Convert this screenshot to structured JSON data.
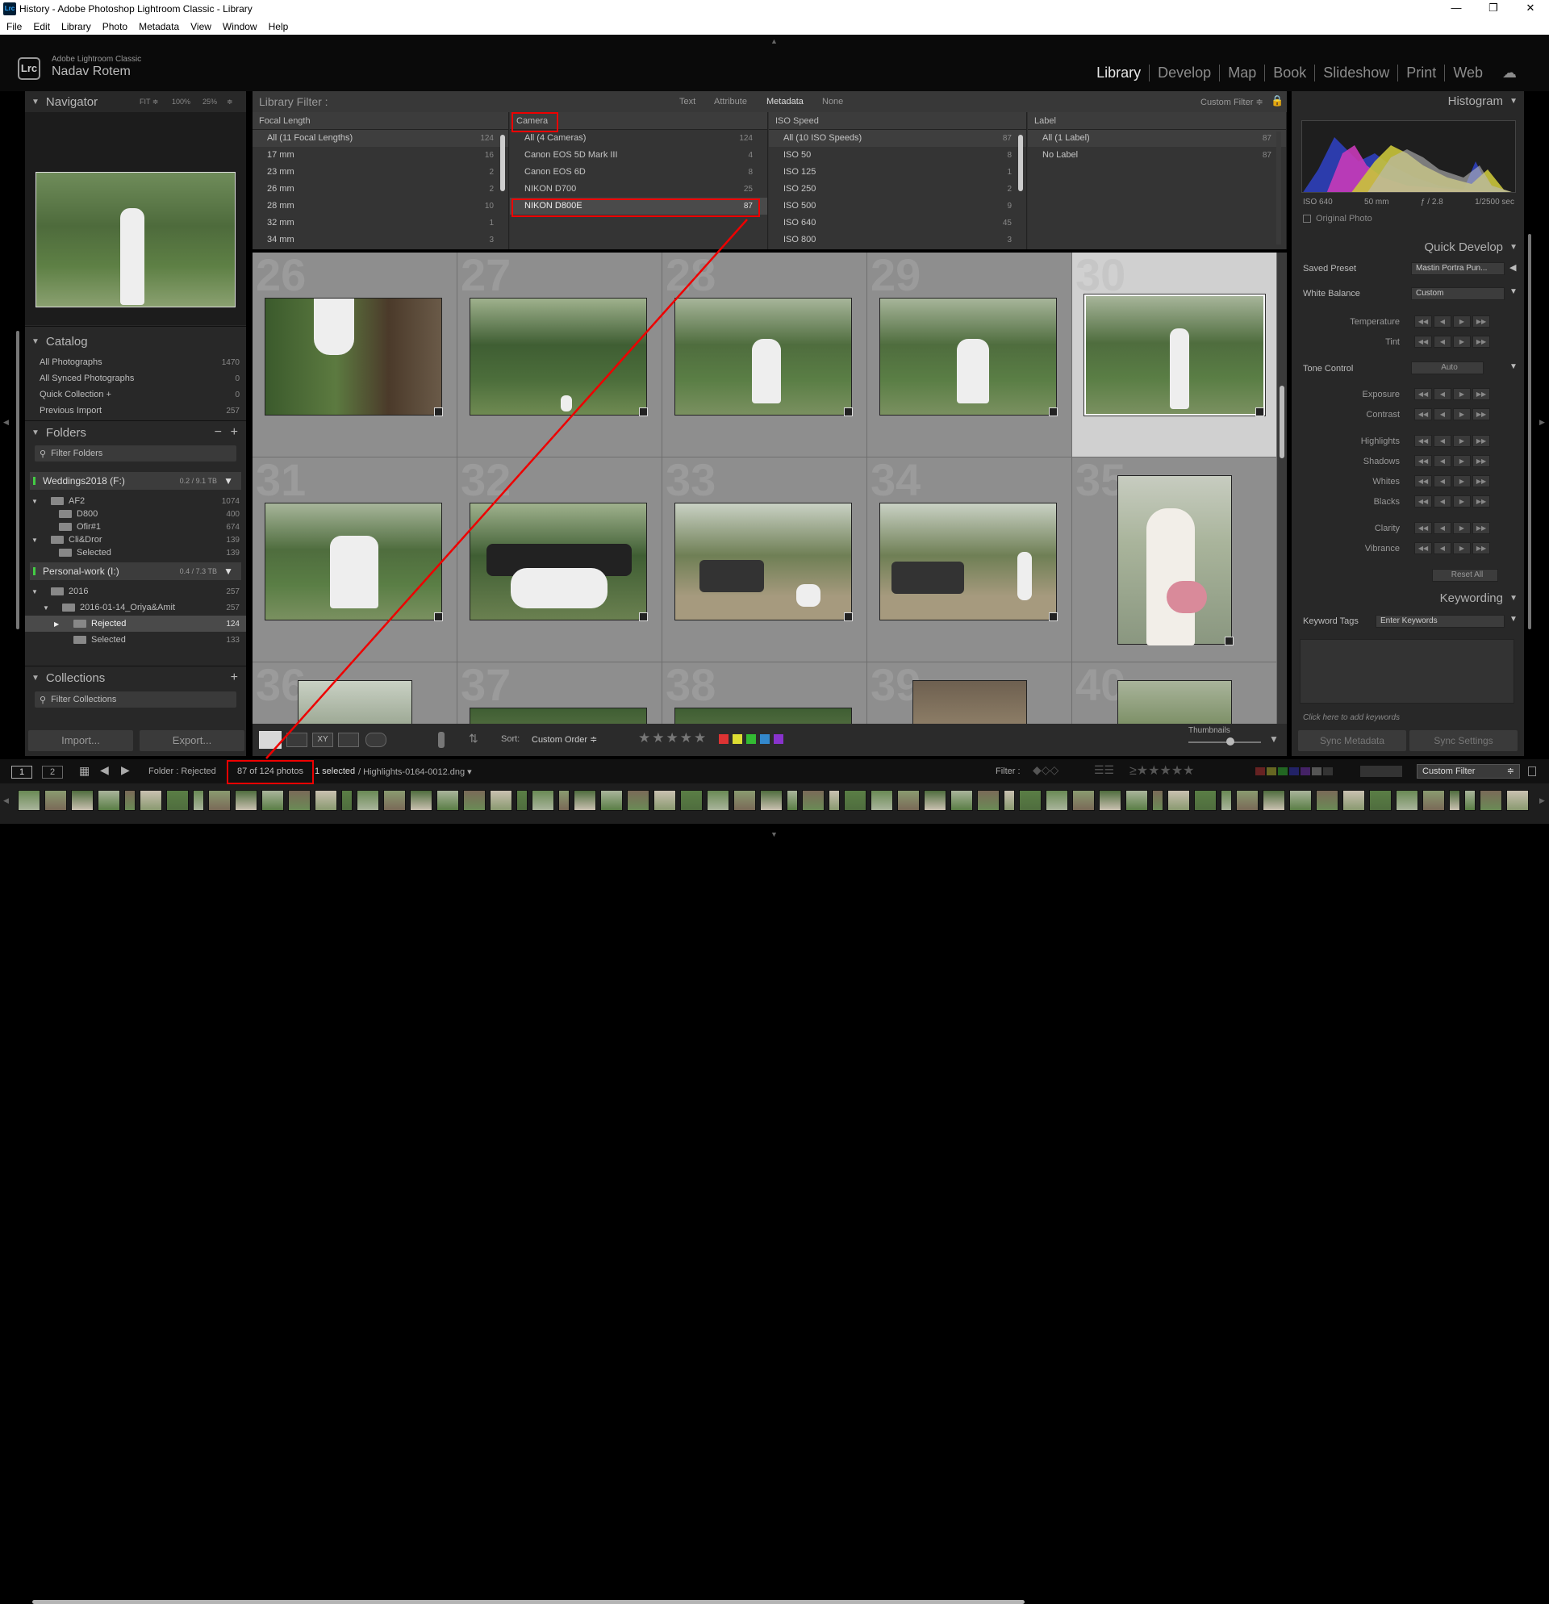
{
  "window": {
    "title": "History - Adobe Photoshop Lightroom Classic - Library",
    "app_icon": "Lrc"
  },
  "menu": [
    "File",
    "Edit",
    "Library",
    "Photo",
    "Metadata",
    "View",
    "Window",
    "Help"
  ],
  "identity": {
    "logo": "Lrc",
    "brand": "Adobe Lightroom Classic",
    "user": "Nadav Rotem"
  },
  "modules": [
    "Library",
    "Develop",
    "Map",
    "Book",
    "Slideshow",
    "Print",
    "Web"
  ],
  "navigator": {
    "title": "Navigator",
    "zoom_options": [
      "FIT ≑",
      "100%",
      "25%",
      "≑"
    ]
  },
  "catalog": {
    "title": "Catalog",
    "items": [
      {
        "label": "All Photographs",
        "count": "1470"
      },
      {
        "label": "All Synced Photographs",
        "count": "0"
      },
      {
        "label": "Quick Collection +",
        "count": "0"
      },
      {
        "label": "Previous Import",
        "count": "257"
      }
    ]
  },
  "folders": {
    "title": "Folders",
    "filter_placeholder": "Filter Folders",
    "vol1": {
      "name": "Weddings2018 (F:)",
      "cap": "0.2 / 9.1 TB"
    },
    "vol1_items": [
      {
        "label": "AF2",
        "count": "1074"
      },
      {
        "label": "D800",
        "count": "400"
      },
      {
        "label": "Ofir#1",
        "count": "674"
      },
      {
        "label": "Cli&Dror",
        "count": "139"
      },
      {
        "label": "Selected",
        "count": "139"
      }
    ],
    "vol2": {
      "name": "Personal-work (I:)",
      "cap": "0.4 / 7.3 TB"
    },
    "vol2_items": [
      {
        "label": "2016",
        "count": "257"
      },
      {
        "label": "2016-01-14_Oriya&Amit",
        "count": "257"
      },
      {
        "label": "Rejected",
        "count": "124"
      },
      {
        "label": "Selected",
        "count": "133"
      }
    ]
  },
  "collections": {
    "title": "Collections",
    "filter_placeholder": "Filter Collections"
  },
  "left_buttons": {
    "import": "Import...",
    "export": "Export..."
  },
  "library_filter": {
    "title": "Library Filter :",
    "modes": [
      "Text",
      "Attribute",
      "Metadata",
      "None"
    ],
    "preset": "Custom Filter ≑",
    "columns": [
      {
        "header": "Focal Length",
        "items": [
          {
            "label": "All (11 Focal Lengths)",
            "count": "124"
          },
          {
            "label": "17 mm",
            "count": "16"
          },
          {
            "label": "23 mm",
            "count": "2"
          },
          {
            "label": "26 mm",
            "count": "2"
          },
          {
            "label": "28 mm",
            "count": "10"
          },
          {
            "label": "32 mm",
            "count": "1"
          },
          {
            "label": "34 mm",
            "count": "3"
          }
        ]
      },
      {
        "header": "Camera",
        "items": [
          {
            "label": "All (4 Cameras)",
            "count": "124"
          },
          {
            "label": "Canon EOS 5D Mark III",
            "count": "4"
          },
          {
            "label": "Canon EOS 6D",
            "count": "8"
          },
          {
            "label": "NIKON D700",
            "count": "25"
          },
          {
            "label": "NIKON D800E",
            "count": "87"
          }
        ]
      },
      {
        "header": "ISO Speed",
        "items": [
          {
            "label": "All (10 ISO Speeds)",
            "count": "87"
          },
          {
            "label": "ISO 50",
            "count": "8"
          },
          {
            "label": "ISO 125",
            "count": "1"
          },
          {
            "label": "ISO 250",
            "count": "2"
          },
          {
            "label": "ISO 500",
            "count": "9"
          },
          {
            "label": "ISO 640",
            "count": "45"
          },
          {
            "label": "ISO 800",
            "count": "3"
          }
        ]
      },
      {
        "header": "Label",
        "items": [
          {
            "label": "All (1 Label)",
            "count": "87"
          },
          {
            "label": "No Label",
            "count": "87"
          }
        ]
      }
    ]
  },
  "grid": {
    "cell_numbers": [
      "26",
      "27",
      "28",
      "29",
      "30",
      "31",
      "32",
      "33",
      "34",
      "35",
      "36",
      "37",
      "38",
      "39",
      "40"
    ]
  },
  "toolbar": {
    "sort_label": "Sort:",
    "sort_value": "Custom Order ≑",
    "thumbnails_label": "Thumbnails"
  },
  "histogram": {
    "title": "Histogram",
    "iso": "ISO 640",
    "focal": "50 mm",
    "aperture": "ƒ / 2.8",
    "shutter": "1/2500 sec",
    "original_photo": "Original Photo"
  },
  "quick_develop": {
    "title": "Quick Develop",
    "saved_preset_label": "Saved Preset",
    "saved_preset_value": "Mastin Portra Pun...",
    "white_balance_label": "White Balance",
    "white_balance_value": "Custom",
    "temperature": "Temperature",
    "tint": "Tint",
    "tone_control": "Tone Control",
    "auto": "Auto",
    "exposure": "Exposure",
    "contrast": "Contrast",
    "highlights": "Highlights",
    "shadows": "Shadows",
    "whites": "Whites",
    "blacks": "Blacks",
    "clarity": "Clarity",
    "vibrance": "Vibrance",
    "reset_all": "Reset All"
  },
  "keywording": {
    "title": "Keywording",
    "tags_label": "Keyword Tags",
    "tags_value": "Enter Keywords",
    "hint": "Click here to add keywords"
  },
  "sync": {
    "metadata": "Sync Metadata",
    "settings": "Sync Settings"
  },
  "filmhead": {
    "screen1": "1",
    "screen2": "2",
    "folder": "Folder : Rejected",
    "photo_count": "87 of 124 photos",
    "selected": "1 selected",
    "filename": "/ Highlights-0164-0012.dng ▾",
    "filter_label": "Filter :",
    "custom_filter": "Custom Filter"
  },
  "colors": {
    "accent_red": "#e00000",
    "panel": "#282828",
    "grid_bg": "#8f8f8f"
  }
}
